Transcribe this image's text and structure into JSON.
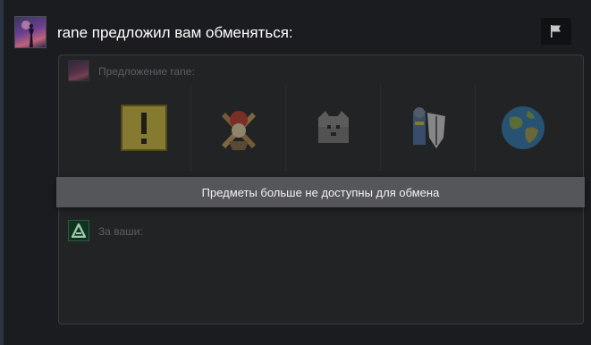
{
  "header": {
    "title": "rane предложил вам обменяться:",
    "avatar_icon": "user-avatar-icon",
    "report_icon": "flag-icon"
  },
  "offer": {
    "label": "Предложение rane:",
    "items": [
      {
        "name": "warning-item",
        "icon": "exclamation-icon"
      },
      {
        "name": "crossed-swords-item",
        "icon": "swords-icon"
      },
      {
        "name": "box-item",
        "icon": "box-icon"
      },
      {
        "name": "knight-shield-item",
        "icon": "knight-icon"
      },
      {
        "name": "globe-item",
        "icon": "globe-icon"
      }
    ]
  },
  "receive": {
    "label": "За ваши:",
    "avatar_icon": "dota-logo-icon"
  },
  "banner": {
    "text": "Предметы больше не доступны для обмена"
  },
  "colors": {
    "background": "#1b1c1f",
    "panel": "#222325",
    "banner": "#55565a",
    "title_text": "#ffffff",
    "muted_text": "#5e5f63"
  }
}
